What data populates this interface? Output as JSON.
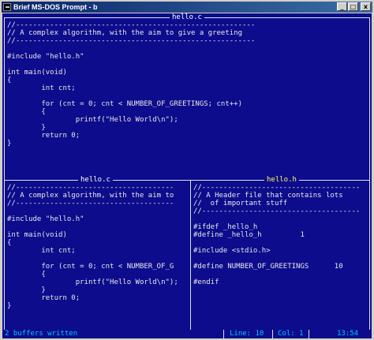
{
  "window": {
    "title": "Brief MS-DOS Prompt - b",
    "minimize_label": "_",
    "maximize_label": "□",
    "close_label": "x"
  },
  "panes": {
    "top": {
      "title": "hello.c",
      "lines": [
        "//--------------------------------------------------------",
        "// A complex algorithm, with the aim to give a greeting",
        "//--------------------------------------------------------",
        "",
        "#include \"hello.h\"",
        "",
        "int main(void)",
        "{",
        "        int cnt;",
        "",
        "        for (cnt = 0; cnt < NUMBER_OF_GREETINGS; cnt++)",
        "        {",
        "                printf(\"Hello World\\n\");",
        "        }",
        "        return 0;",
        "}"
      ]
    },
    "bottom_left": {
      "title": "hello.c",
      "lines": [
        "//-------------------------------------",
        "// A complex algorithm, with the aim to",
        "//-------------------------------------",
        "",
        "#include \"hello.h\"",
        "",
        "int main(void)",
        "{",
        "        int cnt;",
        "",
        "        for (cnt = 0; cnt < NUMBER_OF_G",
        "        {",
        "                printf(\"Hello World\\n\");",
        "        }",
        "        return 0;",
        "}"
      ]
    },
    "bottom_right": {
      "title": "hello.h",
      "lines": [
        "//-------------------------------------",
        "// A Header file that contains lots",
        "//  of important stuff",
        "//-------------------------------------",
        "",
        "#ifdef _hello_h",
        "#define _hello_h         1",
        "",
        "#include <stdio.h>",
        "",
        "#define NUMBER_OF_GREETINGS      10",
        "",
        "#endif"
      ]
    }
  },
  "status": {
    "message": "2 buffers written",
    "line": "Line: 10",
    "col": "Col: 1",
    "time": "13:54"
  },
  "colors": {
    "background": "#0c0c8c",
    "text": "#e8e8e8",
    "active_title": "#ffff55",
    "status_text": "#00c8ff",
    "titlebar": "#0a246a"
  }
}
